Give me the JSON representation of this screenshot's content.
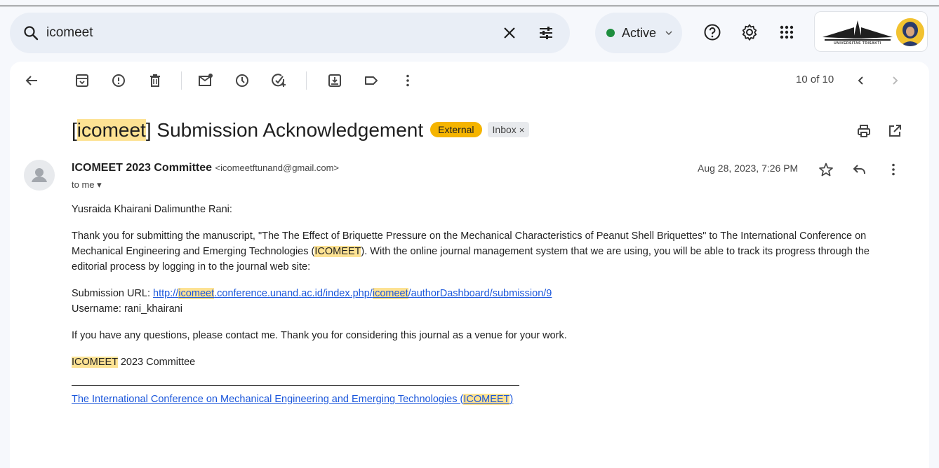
{
  "search": {
    "query": "icomeet"
  },
  "status": {
    "label": "Active",
    "color": "#1e8e3e"
  },
  "account": {
    "logo_text": "UNIVERSITAS TRISAKTI"
  },
  "toolbar": {
    "pager": "10 of 10"
  },
  "email": {
    "subject_pre": "[",
    "subject_hl": "icomeet",
    "subject_post": "] Submission Acknowledgement",
    "label_external": "External",
    "label_inbox": "Inbox",
    "label_inbox_close": "×",
    "sender_name": "ICOMEET 2023 Committee",
    "sender_email": "<icomeetftunand@gmail.com>",
    "to": "to me",
    "date": "Aug 28, 2023, 7:26 PM",
    "greeting": "Yusraida Khairani Dalimunthe Rani:",
    "p1_a": "Thank you for submitting the manuscript, \"The The Effect of Briquette Pressure on the Mechanical Characteristics of Peanut Shell Briquettes\" to The International Conference on Mechanical Engineering and Emerging Technologies (",
    "p1_hl": "ICOMEET",
    "p1_b": "). With the online journal management system that we are using, you will be able to track its progress through the editorial process by logging in to the journal web site:",
    "url_label": "Submission URL: ",
    "url_a": "http://",
    "url_hl1": "icomeet",
    "url_b": ".conference.unand.ac.id/index.php/",
    "url_hl2": "icomeet",
    "url_c": "/authorDashboard/submission/9",
    "username": "Username: rani_khairani",
    "p3": "If you have any questions, please contact me. Thank you for considering this journal as a venue for your work.",
    "sig_hl": "ICOMEET",
    "sig_rest": " 2023 Committee",
    "footer_a": "The International Conference on Mechanical Engineering and Emerging Technologies (",
    "footer_hl": "ICOMEET",
    "footer_b": ")"
  }
}
